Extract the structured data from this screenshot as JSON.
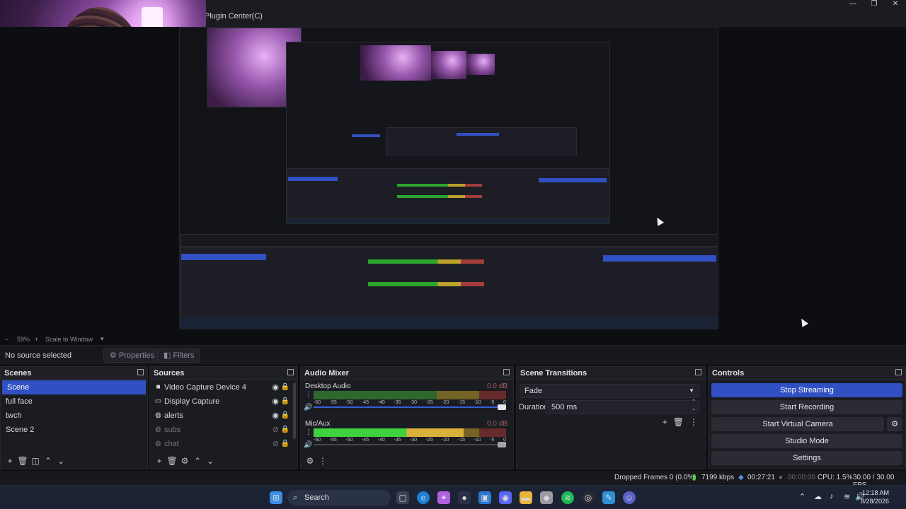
{
  "window": {
    "title": "Plugin Center(C)",
    "controls": [
      "—",
      "❐",
      "✕"
    ]
  },
  "zoom": {
    "minus": "−",
    "level": "59%",
    "plus": "+",
    "scale_mode": "Scale to Window"
  },
  "context": {
    "no_source": "No source selected",
    "properties_label": "Properties",
    "filters_label": "Filters"
  },
  "scenes": {
    "title": "Scenes",
    "items": [
      "Scene",
      "full face",
      "twch",
      "Scene 2"
    ],
    "active_index": 0
  },
  "sources": {
    "title": "Sources",
    "items": [
      {
        "label": "Video Capture Device 4",
        "icon": "camera-icon",
        "visible": true
      },
      {
        "label": "Display Capture",
        "icon": "monitor-icon",
        "visible": true
      },
      {
        "label": "alerts",
        "icon": "globe-icon",
        "visible": true
      },
      {
        "label": "subs",
        "icon": "globe-icon",
        "visible": false
      },
      {
        "label": "chat",
        "icon": "globe-icon",
        "visible": false
      }
    ]
  },
  "mixer": {
    "title": "Audio Mixer",
    "channels": [
      {
        "name": "Desktop Audio",
        "db": "0.0 dB",
        "level": 0
      },
      {
        "name": "Mic/Aux",
        "db": "0.0 dB",
        "level": 0.78
      }
    ],
    "ticks": [
      "-60",
      "-55",
      "-50",
      "-45",
      "-40",
      "-35",
      "-30",
      "-25",
      "-20",
      "-15",
      "-10",
      "-5",
      "0"
    ]
  },
  "transitions": {
    "title": "Scene Transitions",
    "selected": "Fade",
    "duration_label": "Duration",
    "duration_value": "500 ms"
  },
  "controls": {
    "title": "Controls",
    "stop_streaming": "Stop Streaming",
    "start_recording": "Start Recording",
    "start_virtual_camera": "Start Virtual Camera",
    "studio_mode": "Studio Mode",
    "settings": "Settings"
  },
  "status": {
    "dropped_frames": "Dropped Frames 0 (0.0%)",
    "bitrate": "7199 kbps",
    "stream_time": "00:27:21",
    "record_time": "00:00:00",
    "cpu": "CPU: 1.5%",
    "fps": "30.00 / 30.00 FPS"
  },
  "taskbar": {
    "search_label": "Search",
    "time": "12:18 AM",
    "date": "8/28/2026"
  },
  "colors": {
    "accent": "#3150c4",
    "meter_green": "#48d648",
    "meter_yellow": "#d8b23a",
    "meter_red": "#a53c3c"
  }
}
